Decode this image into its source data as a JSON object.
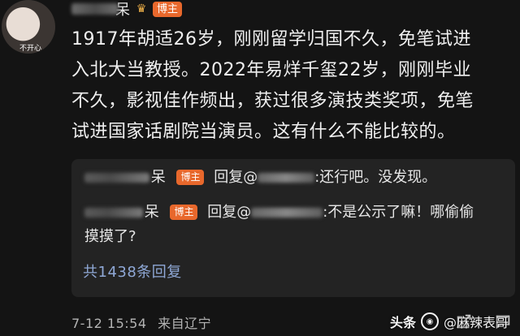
{
  "post": {
    "avatar_caption": "不开心",
    "username_visible": "呆",
    "badge": "博主",
    "comment_lines": [
      "1917年胡适26岁，刚刚留学归国不久，免笔试进",
      "入北大当教授。2022年易烊千玺22岁，刚刚毕业",
      "不久，影视佳作频出，获过很多演技类奖项，免笔",
      "试进国家话剧院当演员。这有什么不能比较的。"
    ]
  },
  "replies": [
    {
      "name_visible": "呆",
      "badge": "博主",
      "prefix": "回复@",
      "suffix": ":还行吧。没发现。"
    },
    {
      "name_visible": "呆",
      "badge": "博主",
      "prefix": "回复@",
      "suffix": ":不是公示了嘛！哪偷偷",
      "line2": "摸摸了?"
    }
  ],
  "reply_more": "共1438条回复",
  "meta": {
    "date": "7-12 15:54",
    "location": "来自辽宁"
  },
  "watermark": {
    "left": "头条",
    "handle": "@麻辣表哥"
  },
  "icons": [
    "crown-icon",
    "share-icon",
    "comment-icon",
    "like-icon"
  ]
}
